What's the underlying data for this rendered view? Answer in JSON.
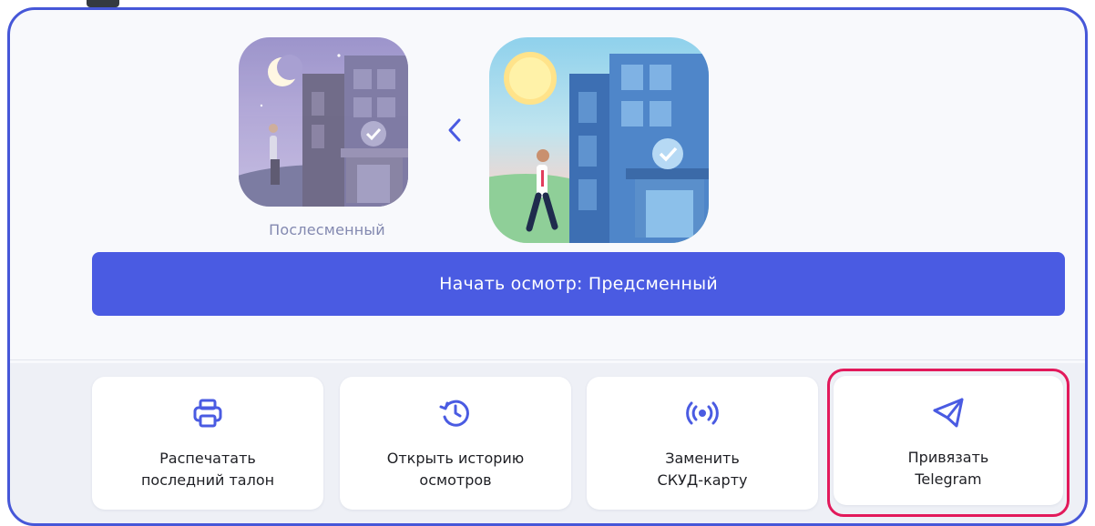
{
  "shifts": {
    "night_label": "Послесменный",
    "comparator": "<"
  },
  "start_button": {
    "label": "Начать осмотр: Предсменный"
  },
  "actions": [
    {
      "line1": "Распечатать",
      "line2": "последний талон",
      "icon": "printer-icon"
    },
    {
      "line1": "Открыть историю",
      "line2": "осмотров",
      "icon": "history-icon"
    },
    {
      "line1": "Заменить",
      "line2": "СКУД-карту",
      "icon": "nfc-signal-icon"
    },
    {
      "line1": "Привязать",
      "line2": "Telegram",
      "icon": "telegram-icon"
    }
  ],
  "colors": {
    "accent": "#4a5be2",
    "frame": "#4657d8",
    "highlight": "#e2195b"
  }
}
